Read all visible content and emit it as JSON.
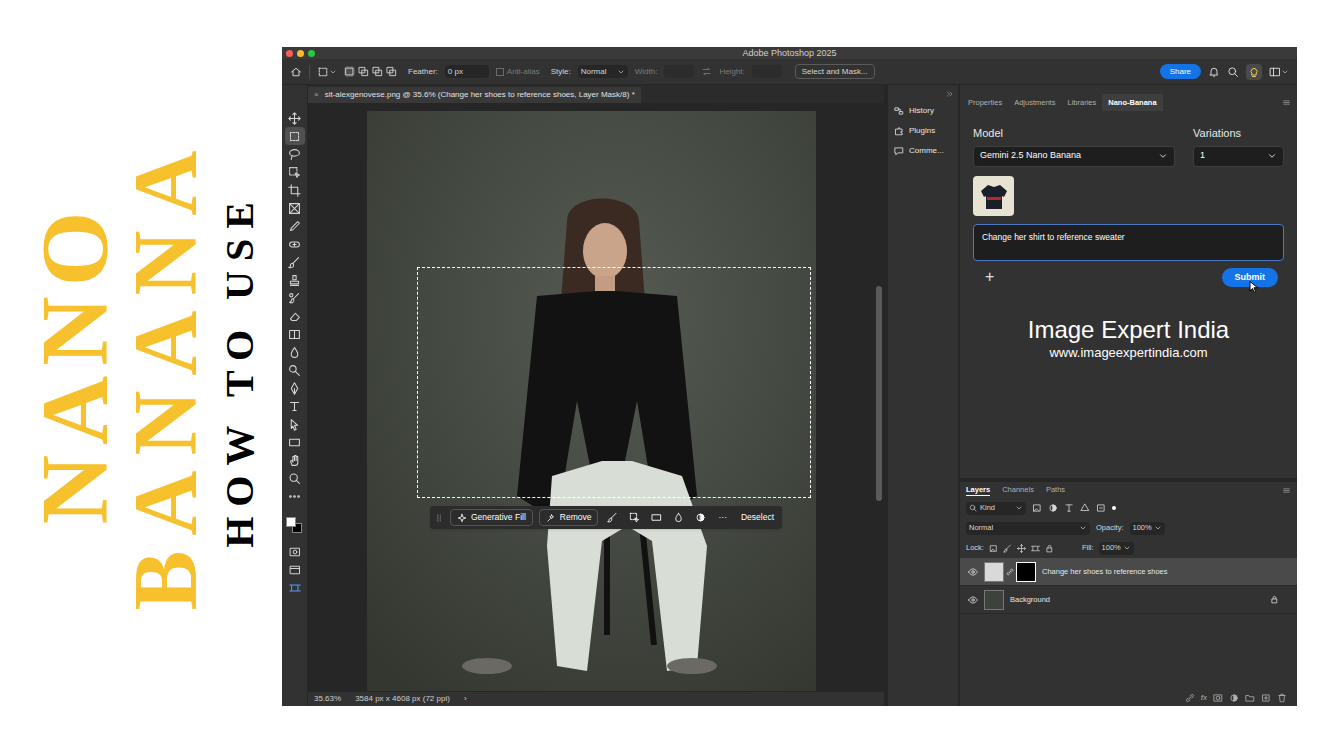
{
  "thumbnail": {
    "line1": "NANO",
    "line2": "BANANA",
    "line3": "HOW TO USE"
  },
  "window": {
    "title": "Adobe Photoshop 2025"
  },
  "options_bar": {
    "feather_label": "Feather:",
    "feather": "0 px",
    "anti_alias": {
      "label": "Anti-alias",
      "disabled": true,
      "checked": false
    },
    "style_label": "Style:",
    "style": "Normal",
    "width": {
      "label": "Width:",
      "disabled": true
    },
    "height": {
      "label": "Height:",
      "disabled": true
    },
    "select_mask": "Select and Mask...",
    "share": "Share",
    "learn_active": true
  },
  "document": {
    "close": "×",
    "title": "sit-alexgenovese.png @ 35.6% (Change her shoes to reference shoes, Layer Mask/8) *"
  },
  "tools": [
    {
      "selected": false
    },
    {
      "selected": true
    },
    {
      "selected": false
    },
    {
      "selected": false
    },
    {
      "selected": false
    },
    {
      "selected": false
    },
    {
      "selected": false
    },
    {
      "selected": false
    },
    {
      "selected": false
    },
    {
      "selected": false
    },
    {
      "selected": false
    },
    {
      "selected": false
    },
    {
      "selected": false
    },
    {
      "selected": false
    },
    {
      "selected": false
    },
    {
      "selected": false
    },
    {
      "selected": false
    },
    {
      "selected": false
    },
    {
      "selected": false
    },
    {
      "selected": false
    },
    {
      "selected": false
    },
    {
      "selected": false
    }
  ],
  "context_taskbar": {
    "buttons": [
      {
        "label": "Generative Fill"
      },
      {
        "label": "Remove"
      }
    ],
    "more": "···",
    "deselect": "Deselect"
  },
  "status_bar": {
    "zoom": "35.63%",
    "size": "3584 px x 4608 px (72 ppi)",
    "arrow": "›"
  },
  "dock": [
    {
      "label": "History"
    },
    {
      "label": "Plugins"
    },
    {
      "label": "Comme..."
    }
  ],
  "panel_tabs": [
    {
      "label": "Properties",
      "selected": false
    },
    {
      "label": "Adjustments",
      "selected": false
    },
    {
      "label": "Libraries",
      "selected": false
    },
    {
      "label": "Nano-Banana",
      "selected": true
    }
  ],
  "nano_banana": {
    "model_label": "Model",
    "model": "Gemini 2.5 Nano Banana",
    "variations_label": "Variations",
    "variations": "1",
    "prompt": "Change her shirt to reference sweater",
    "add": "+",
    "submit": "Submit"
  },
  "watermark": {
    "name": "Image Expert India",
    "url": "www.imageexpertindia.com"
  },
  "layers_tabs": [
    {
      "label": "Layers",
      "selected": true
    },
    {
      "label": "Channels",
      "selected": false
    },
    {
      "label": "Paths",
      "selected": false
    }
  ],
  "layers_controls": {
    "filter": "Kind",
    "blend_mode": "Normal",
    "opacity_label": "Opacity:",
    "opacity": "100%",
    "lock_label": "Lock:",
    "fill_label": "Fill:",
    "fill": "100%"
  },
  "layers": [
    {
      "name": "Change her shoes to reference shoes",
      "selected": true,
      "visible": true,
      "kind": "masked",
      "locked": false
    },
    {
      "name": "Background",
      "selected": false,
      "visible": true,
      "kind": "background",
      "locked": true
    }
  ],
  "layers_footer": {
    "fx": "fx"
  }
}
